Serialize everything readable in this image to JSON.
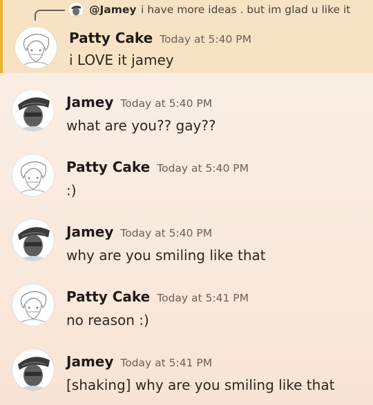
{
  "reply_preview": {
    "author": "@Jamey",
    "text": "i have more ideas . but im glad u like it"
  },
  "messages": [
    {
      "author": "Patty Cake",
      "timestamp": "Today at 5:40 PM",
      "content": "i LOVE it jamey",
      "avatar_icon": "patty-cake-avatar",
      "highlighted": true
    },
    {
      "author": "Jamey",
      "timestamp": "Today at 5:40 PM",
      "content": "what are you?? gay??",
      "avatar_icon": "jamey-avatar"
    },
    {
      "author": "Patty Cake",
      "timestamp": "Today at 5:40 PM",
      "content": ":)",
      "avatar_icon": "patty-cake-avatar"
    },
    {
      "author": "Jamey",
      "timestamp": "Today at 5:40 PM",
      "content": "why are you smiling like that",
      "avatar_icon": "jamey-avatar"
    },
    {
      "author": "Patty Cake",
      "timestamp": "Today at 5:41 PM",
      "content": "no reason :)",
      "avatar_icon": "patty-cake-avatar"
    },
    {
      "author": "Jamey",
      "timestamp": "Today at 5:41 PM",
      "content": "[shaking] why are you smiling like that",
      "avatar_icon": "jamey-avatar"
    }
  ],
  "colors": {
    "highlight_bg": "#f7e3c4",
    "highlight_bar": "#f0b232",
    "background_top": "#fbf0e7",
    "background_bottom": "#f8e4d6"
  }
}
